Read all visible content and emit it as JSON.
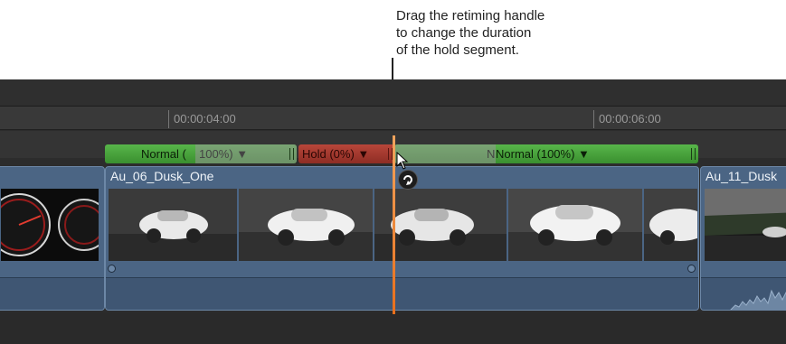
{
  "callout": {
    "lines": [
      "Drag the retiming handle",
      "to change the duration",
      "of the hold segment."
    ]
  },
  "ruler": {
    "timecodes": [
      "00:00:04:00",
      "00:00:06:00"
    ]
  },
  "retime": {
    "segments": [
      {
        "label": "Normal (",
        "faded": "100%) ▼",
        "type": "normal"
      },
      {
        "label": "Hold (0%) ▼",
        "type": "hold"
      },
      {
        "label": "Normal (100%) ▼",
        "faded_prefix": "N",
        "type": "normal"
      }
    ]
  },
  "clips": [
    {
      "title": ""
    },
    {
      "title": "Au_06_Dusk_One"
    },
    {
      "title": "Au_11_Dusk"
    }
  ],
  "colors": {
    "timeline_bg": "#2c2c2c",
    "clip_blue": "#4b6584",
    "retime_green": "#4aa23c",
    "retime_red": "#a53b30",
    "playhead_orange": "#ee7f24"
  },
  "icons": {
    "cursor": "arrow-pointer-icon",
    "retime_handle": "retime-handle-icon"
  }
}
